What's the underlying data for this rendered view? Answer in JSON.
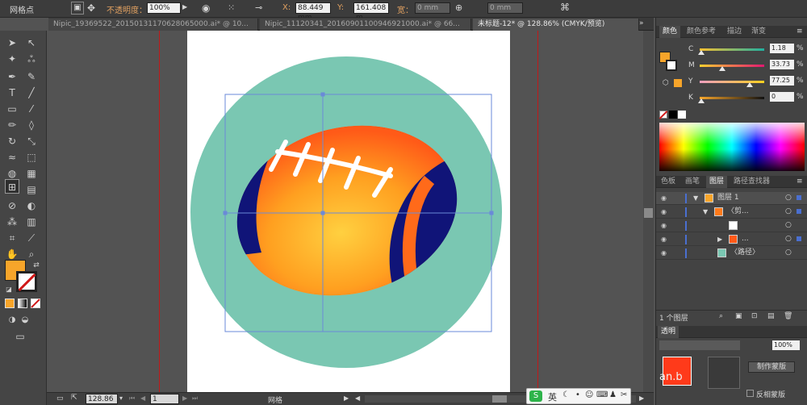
{
  "topbar": {
    "mode_label": "网格点",
    "opacity_label": "不透明度：",
    "opacity_value": "100%",
    "x_label": "X:",
    "x_value": "88.449 mm",
    "y_label": "Y:",
    "y_value": "161.408 m",
    "width_label": "宽：",
    "width_value": "0 mm",
    "height_value": "0 mm"
  },
  "tabs": [
    {
      "label": "Nipic_19369522_20150131170628065000.ai* @ 10..."
    },
    {
      "label": "Nipic_11120341_20160901100946921000.ai* @ 66..."
    },
    {
      "label": "未标题-12* @ 128.86% (CMYK/预览)"
    }
  ],
  "status": {
    "zoom": "128.86",
    "page": "1",
    "mode": "网格"
  },
  "color_panel": {
    "tabs": [
      "颜色",
      "颜色参考",
      "描边",
      "渐变"
    ],
    "channels": [
      {
        "name": "C",
        "value": "1.18"
      },
      {
        "name": "M",
        "value": "33.73"
      },
      {
        "name": "Y",
        "value": "77.25"
      },
      {
        "name": "K",
        "value": "0"
      }
    ],
    "percent": "%"
  },
  "layers_panel": {
    "tabs": [
      "色板",
      "画笔",
      "图层",
      "路径查找器"
    ],
    "rows": [
      {
        "name": "图层 1"
      },
      {
        "name": "〈剪..."
      },
      {
        "name": ""
      },
      {
        "name": "..."
      },
      {
        "name": "〈路径〉"
      }
    ],
    "footer": "1 个图层"
  },
  "transparency_panel": {
    "tab": "透明",
    "opacity": "100%",
    "make_mask": "制作蒙版",
    "invert_mask": "反相蒙版",
    "watermark": "an.b"
  },
  "ime": {
    "label": "英"
  },
  "colors": {
    "circle": "#7ac7b2",
    "ball_orange": "#ff7a1a",
    "ball_yellow": "#ffd040",
    "stripe": "#101478",
    "fill_swatch": "#f7a52a"
  }
}
